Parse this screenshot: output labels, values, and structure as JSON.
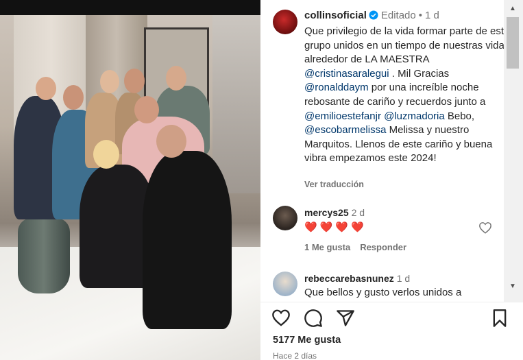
{
  "post": {
    "author": {
      "username": "collinsoficial",
      "verified": true,
      "edited_label": "Editado",
      "separator": "•",
      "time": "1 d"
    },
    "caption": {
      "part1": "Que privilegio de la vida formar parte de este grupo unidos en un tiempo de nuestras vidas alrededor de LA MAESTRA ",
      "mention1": "@cristinasaralegui",
      "part2": " . Mil Gracias ",
      "mention2": "@ronalddaym",
      "part3": " por una increíble noche rebosante de cariño y recuerdos junto a ",
      "mention3": "@emilioestefanjr",
      "part4": " ",
      "mention4": "@luzmadoria",
      "part5": " Bebo, ",
      "mention5": "@escobarmelissa",
      "part6": " Melissa y nuestro Marquitos. Llenos de este cariño y buena vibra empezamos este 2024!"
    },
    "translate_label": "Ver traducción",
    "comments": [
      {
        "username": "mercys25",
        "time": "2 d",
        "text": "❤️❤️❤️❤️",
        "likes_label": "1 Me gusta",
        "reply_label": "Responder"
      },
      {
        "username": "rebeccarebasnunez",
        "time": "1 d",
        "text": "Que bellos y gusto verlos unidos a"
      }
    ],
    "likes_count": "5177 Me gusta",
    "date": "Hace 2 días"
  },
  "icons": {
    "like": "heart-icon",
    "comment": "comment-icon",
    "share": "share-icon",
    "save": "bookmark-icon"
  },
  "colors": {
    "mention": "#00376b",
    "heart": "#ed0f3a",
    "verified": "#0095f6",
    "secondary_text": "#737373"
  }
}
